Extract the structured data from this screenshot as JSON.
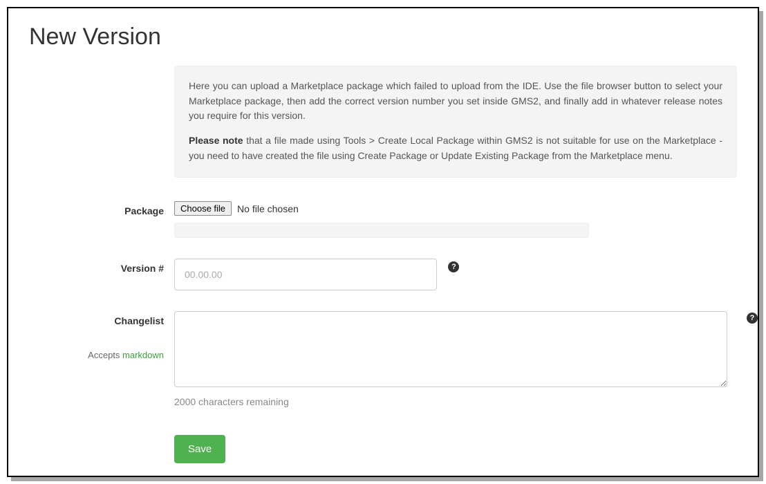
{
  "page": {
    "title": "New Version"
  },
  "info": {
    "paragraph1": "Here you can upload a Marketplace package which failed to upload from the IDE. Use the file browser button to select your Marketplace package, then add the correct version number you set inside GMS2, and finally add in whatever release notes you require for this version.",
    "note_strong": "Please note",
    "note_rest": " that a file made using Tools > Create Local Package within GMS2 is not suitable for use on the Marketplace - you need to have created the file using Create Package or Update Existing Package from the Marketplace menu."
  },
  "labels": {
    "package": "Package",
    "version": "Version #",
    "changelist": "Changelist",
    "accepts_prefix": "Accepts ",
    "markdown_link": "markdown"
  },
  "file": {
    "choose_button": "Choose file",
    "no_file_text": "No file chosen"
  },
  "version": {
    "value": "",
    "placeholder": "00.00.00"
  },
  "changelist": {
    "value": "",
    "remaining_text": "2000 characters remaining"
  },
  "buttons": {
    "save": "Save"
  },
  "icons": {
    "help_glyph": "?"
  }
}
